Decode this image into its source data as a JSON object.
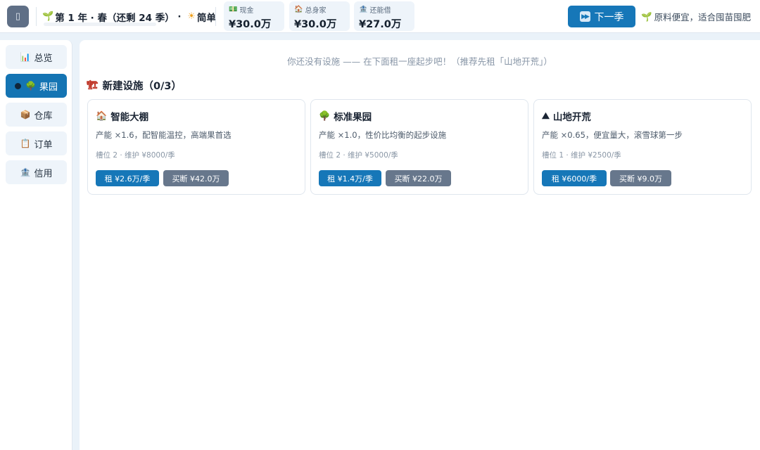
{
  "topbar": {
    "menu_icon": "menu-icon",
    "season": {
      "sprout_icon": "🌱",
      "label": "第 1 年 · 春（还剩 24 季）",
      "separator": " · ",
      "weather_icon": "☀",
      "difficulty": "简单"
    },
    "stats": [
      {
        "icon": "💵",
        "label": "现金",
        "value": "¥30.0万"
      },
      {
        "icon": "🏠",
        "label": "总身家",
        "value": "¥30.0万"
      },
      {
        "icon": "🏦",
        "label": "还能借",
        "value": "¥27.0万"
      }
    ],
    "next_button": {
      "icon": "⏩",
      "label": "下一季"
    },
    "tip": {
      "icon": "🌱",
      "text": "原料便宜，适合囤苗囤肥"
    }
  },
  "sidebar": {
    "items": [
      {
        "icon": "📊",
        "label": "总览",
        "active": false
      },
      {
        "icon": "🌳",
        "label": "果园",
        "active": true
      },
      {
        "icon": "📦",
        "label": "仓库",
        "active": false
      },
      {
        "icon": "📋",
        "label": "订单",
        "active": false
      },
      {
        "icon": "🏦",
        "label": "信用",
        "active": false
      }
    ]
  },
  "main": {
    "empty_message": "你还没有设施 —— 在下面租一座起步吧！（推荐先租「山地开荒」）",
    "section": {
      "icon": "🏗",
      "title": "新建设施（0/3）"
    },
    "facilities": [
      {
        "icon": "🏠",
        "name": "智能大棚",
        "desc": "产能 ×1.6，配智能温控，高端果首选",
        "meta": "槽位 2 · 维护 ¥8000/季",
        "rent_label": "租 ¥2.6万/季",
        "buy_label": "买断 ¥42.0万"
      },
      {
        "icon": "🌳",
        "name": "标准果园",
        "desc": "产能 ×1.0，性价比均衡的起步设施",
        "meta": "槽位 2 · 维护 ¥5000/季",
        "rent_label": "租 ¥1.4万/季",
        "buy_label": "买断 ¥22.0万"
      },
      {
        "icon": "⛰",
        "name": "山地开荒",
        "desc": "产能 ×0.65，便宜量大，滚雪球第一步",
        "meta": "槽位 1 · 维护 ¥2500/季",
        "rent_label": "租 ¥6000/季",
        "buy_label": "买断 ¥9.0万"
      }
    ]
  },
  "colors": {
    "accent": "#1677b8",
    "secondary_button": "#67778c",
    "background": "#eaf2f9"
  }
}
